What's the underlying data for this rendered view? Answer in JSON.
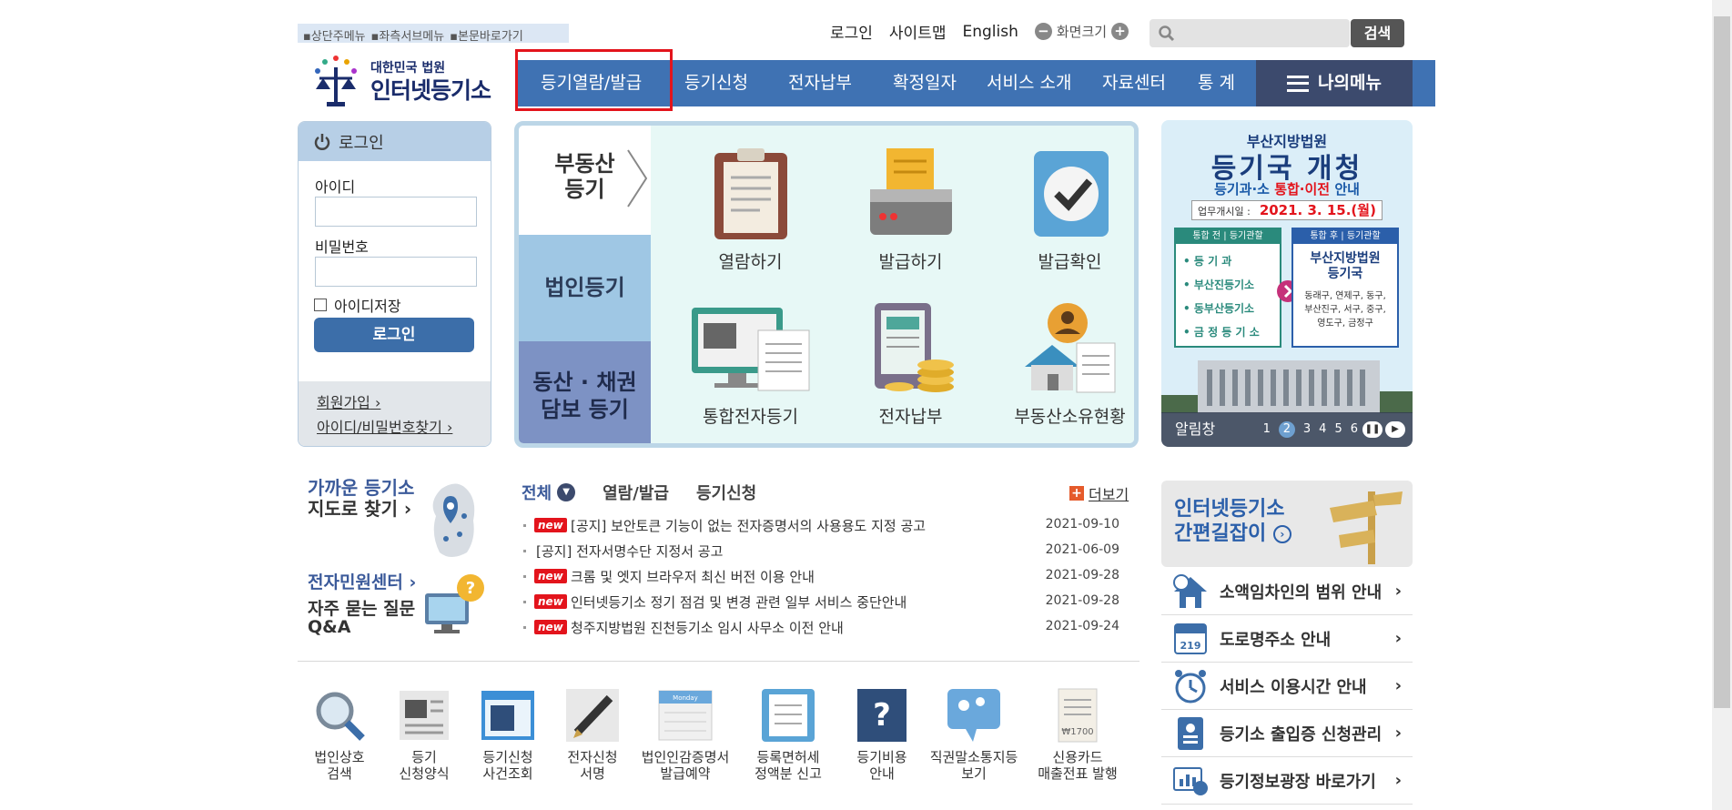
{
  "skip_links": [
    "▪상단주메뉴",
    "▪좌측서브메뉴",
    "▪본문바로가기"
  ],
  "util": {
    "login": "로그인",
    "sitemap": "사이트맵",
    "english": "English",
    "screen_size": "화면크기",
    "minus": "−",
    "plus": "+"
  },
  "search": {
    "placeholder": "",
    "button": "검색"
  },
  "logo": {
    "line1": "대한민국 법원",
    "line2": "인터넷등기소"
  },
  "gnb": [
    "등기열람/발급",
    "등기신청",
    "전자납부",
    "확정일자",
    "서비스 소개",
    "자료센터",
    "통 계"
  ],
  "my_menu": "나의메뉴",
  "login": {
    "title": "로그인",
    "id_label": "아이디",
    "pw_label": "비밀번호",
    "remember": "아이디저장",
    "button": "로그인",
    "join": "회원가입",
    "find": "아이디/비밀번호찾기"
  },
  "service_tabs": {
    "tab1_line1": "부동산",
    "tab1_line2": "등기",
    "tab2": "법인등기",
    "tab3_line1": "동산 · 채권",
    "tab3_line2": "담보 등기"
  },
  "services": [
    "열람하기",
    "발급하기",
    "발급확인",
    "통합전자등기",
    "전자납부",
    "부동산소유현황"
  ],
  "banner": {
    "line1": "부산지방법원",
    "line2": "등기국 개청",
    "line3a": "등기과·소 ",
    "line3b": "통합·이전",
    "line3c": " 안내",
    "date_label": "업무개시일 :",
    "date": "2021. 3. 15.(월)",
    "before_head": "통합 전 | 등기관할",
    "before_items": [
      "등 기 과",
      "부산진등기소",
      "동부산등기소",
      "금 정 등 기 소"
    ],
    "after_head": "통합 후 | 등기관할",
    "after_title1": "부산지방법원",
    "after_title2": "등기국",
    "after_desc1": "동래구, 연제구, 동구,",
    "after_desc2": "부산진구, 서구, 중구,",
    "after_desc3": "영도구, 금정구",
    "footer": "알림창",
    "pages": [
      "1",
      "2",
      "3",
      "4",
      "5",
      "6"
    ],
    "current_page": "2"
  },
  "near": {
    "line1": "가까운 등기소",
    "line2": "지도로 찾기 ›"
  },
  "civil": "전자민원센터 ›",
  "faq": {
    "line1": "자주 묻는 질문",
    "line2": "Q&A"
  },
  "news_tabs": [
    "전체",
    "열람/발급",
    "등기신청"
  ],
  "more": "더보기",
  "new_badge": "new",
  "news": [
    {
      "new": true,
      "title": "[공지] 보안토큰 기능이 없는 전자증명서의 사용용도 지정 공고",
      "date": "2021-09-10"
    },
    {
      "new": false,
      "title": "[공지] 전자서명수단 지정서 공고",
      "date": "2021-06-09"
    },
    {
      "new": true,
      "title": "크롬 및 엣지 브라우저 최신 버전 이용 안내",
      "date": "2021-09-28"
    },
    {
      "new": true,
      "title": "인터넷등기소 정기 점검 및 변경 관련 일부 서비스 중단안내",
      "date": "2021-09-28"
    },
    {
      "new": true,
      "title": "청주지방법원 진천등기소 임시 사무소 이전 안내",
      "date": "2021-09-24"
    }
  ],
  "quick": [
    {
      "l1": "법인상호",
      "l2": "검색"
    },
    {
      "l1": "등기",
      "l2": "신청양식"
    },
    {
      "l1": "등기신청",
      "l2": "사건조회"
    },
    {
      "l1": "전자신청",
      "l2": "서명"
    },
    {
      "l1": "법인인감증명서",
      "l2": "발급예약"
    },
    {
      "l1": "등록면허세",
      "l2": "정액분 신고"
    },
    {
      "l1": "등기비용",
      "l2": "안내"
    },
    {
      "l1": "직권말소통지등",
      "l2": "보기"
    },
    {
      "l1": "신용카드",
      "l2": "매출전표 발행"
    }
  ],
  "quick_icon_text": {
    "calendar": "Monday",
    "receipt": "₩1700",
    "question": "?",
    "address": "219"
  },
  "guide": {
    "line1": "인터넷등기소",
    "line2": "간편길잡이"
  },
  "right_links": [
    "소액임차인의 범위 안내",
    "도로명주소 안내",
    "서비스 이용시간 안내",
    "등기소 출입증 신청관리",
    "등기정보광장 바로가기"
  ],
  "colors": {
    "nav": "#3f72b3",
    "my_menu": "#3c4a6d",
    "highlight": "#e3141c"
  }
}
